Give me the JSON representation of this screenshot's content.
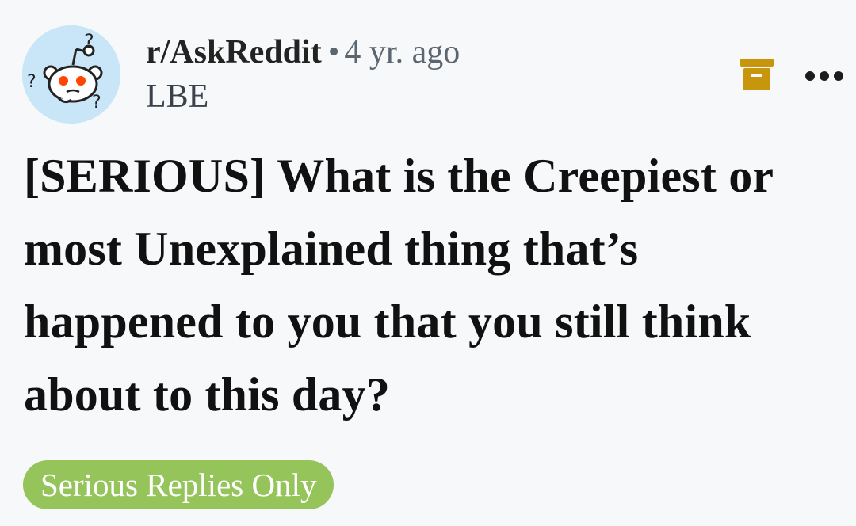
{
  "post": {
    "subreddit": "r/AskReddit",
    "separator": "•",
    "age": "4 yr. ago",
    "username": "LBE",
    "title": "[SERIOUS] What is the Creepiest or most Unexplained thing that’s happened to you that you still think about to this day?",
    "flair": "Serious Replies Only"
  },
  "icons": {
    "avatar": "confused-snoo-avatar",
    "archive": "archive-icon",
    "more": "more-options-icon"
  },
  "colors": {
    "background": "#f7f8fa",
    "flair_background": "#95c45a",
    "archive_icon": "#c8960c",
    "avatar_background": "#c8e6f8"
  }
}
